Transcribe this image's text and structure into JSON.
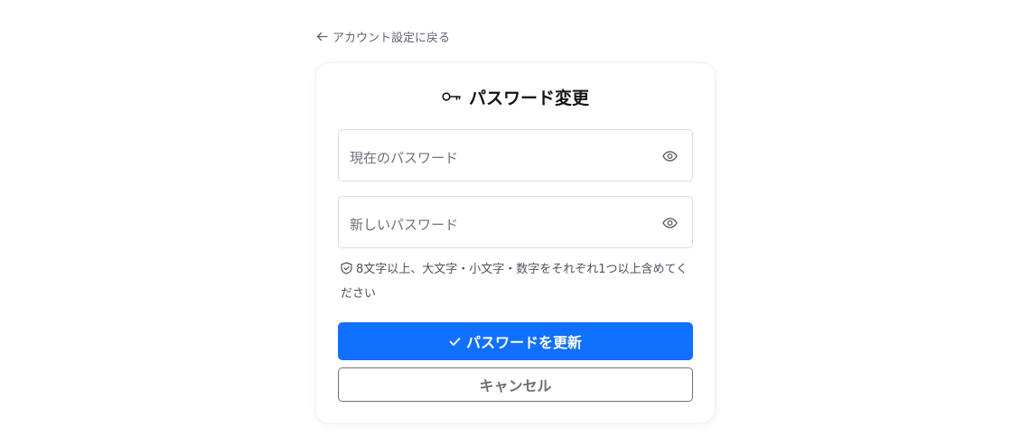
{
  "nav": {
    "back_label": "アカウント設定に戻る",
    "back_icon": "arrow-left-icon"
  },
  "form": {
    "title": "パスワード変更",
    "title_icon": "key-icon",
    "current_password": {
      "placeholder": "現在のパスワード",
      "value": "",
      "toggle_icon": "eye-icon"
    },
    "new_password": {
      "placeholder": "新しいパスワード",
      "value": "",
      "toggle_icon": "eye-icon"
    },
    "hint": {
      "icon": "shield-icon",
      "text": "8文字以上、大文字・小文字・数字をそれぞれ1つ以上含めてください"
    },
    "submit": {
      "label": "パスワードを更新",
      "icon": "check-icon"
    },
    "cancel": {
      "label": "キャンセル"
    }
  },
  "colors": {
    "primary": "#1070ff",
    "muted_text": "#6b7079",
    "border": "#d9dce1"
  }
}
